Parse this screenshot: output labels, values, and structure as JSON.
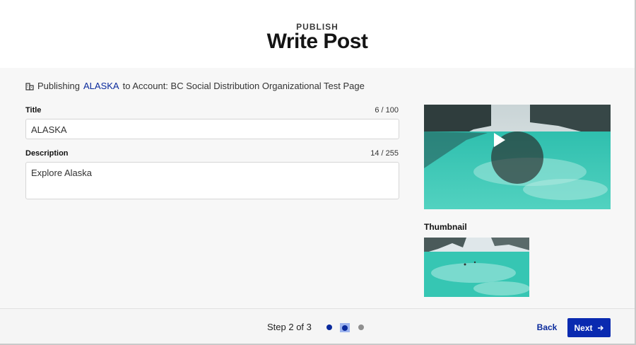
{
  "header": {
    "eyebrow": "PUBLISH",
    "title": "Write Post"
  },
  "publish_info": {
    "prefix": "Publishing",
    "asset_name": "ALASKA",
    "suffix": "to Account: BC Social Distribution Organizational Test Page",
    "icon": "building-icon"
  },
  "form": {
    "title_label": "Title",
    "title_counter": "6 / 100",
    "title_value": "ALASKA",
    "description_label": "Description",
    "description_counter": "14 / 255",
    "description_value": "Explore Alaska"
  },
  "media": {
    "play_icon": "play-icon",
    "thumbnail_label": "Thumbnail"
  },
  "footer": {
    "step_text": "Step 2 of 3",
    "total_steps": 3,
    "current_step": 2,
    "back_label": "Back",
    "next_label": "Next",
    "next_icon": "arrow-right-icon"
  },
  "colors": {
    "accent": "#0a2ab0",
    "link": "#0a2a9c",
    "page_bg": "#f7f7f7"
  }
}
